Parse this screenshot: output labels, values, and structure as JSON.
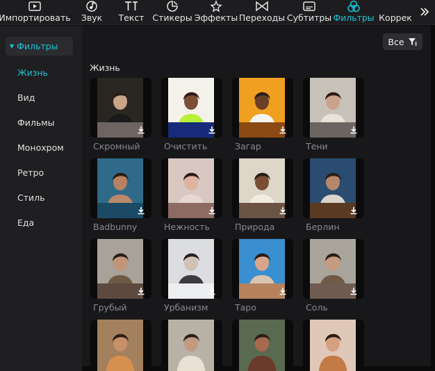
{
  "toolbar": {
    "items": [
      {
        "label": "Импортировать",
        "icon": "import-icon"
      },
      {
        "label": "Звук",
        "icon": "audio-icon"
      },
      {
        "label": "Текст",
        "icon": "text-icon"
      },
      {
        "label": "Стикеры",
        "icon": "sticker-icon"
      },
      {
        "label": "Эффекты",
        "icon": "effects-icon"
      },
      {
        "label": "Переходы",
        "icon": "transitions-icon"
      },
      {
        "label": "Субтитры",
        "icon": "subtitles-icon"
      },
      {
        "label": "Фильтры",
        "icon": "filters-icon",
        "active": true
      },
      {
        "label": "Коррек",
        "icon": "adjust-icon"
      }
    ],
    "accent": "#19c6d6"
  },
  "sidebar": {
    "header": "Фильтры",
    "items": [
      "Жизнь",
      "Вид",
      "Фильмы",
      "Монохром",
      "Ретро",
      "Стиль",
      "Еда"
    ],
    "active": "Жизнь"
  },
  "main": {
    "filter_button": "Все",
    "section_title": "Жизнь",
    "cards": [
      {
        "label": "Скромный",
        "bg": "#2a2622",
        "subject": "#1a1a1a",
        "skin": "#c9a58a",
        "swatch": "#6e6461"
      },
      {
        "label": "Очистить",
        "bg": "#f4f1ea",
        "subject": "#b8f03a",
        "skin": "#7b4f35",
        "swatch": "#182a7a"
      },
      {
        "label": "Загар",
        "bg": "#f0a020",
        "subject": "#f5f5f0",
        "skin": "#6a3f28",
        "swatch": "#8a4a12"
      },
      {
        "label": "Тени",
        "bg": "#c8c1b8",
        "subject": "#e8e2d8",
        "skin": "#c9a38c",
        "swatch": "#6c6461"
      },
      {
        "label": "Badbunny",
        "bg": "#2f6a8a",
        "subject": "#b98a6a",
        "skin": "#b88262",
        "swatch": "#1c4a64"
      },
      {
        "label": "Нежность",
        "bg": "#d9c7c2",
        "subject": "#e8d8d2",
        "skin": "#e0b2a0",
        "swatch": "#8c6b62"
      },
      {
        "label": "Природа",
        "bg": "#ddd6c9",
        "subject": "#f2ece0",
        "skin": "#7a4e34",
        "swatch": "#6c5444"
      },
      {
        "label": "Берлин",
        "bg": "#2a4c70",
        "subject": "#d9d4cc",
        "skin": "#b6876a",
        "swatch": "#5a3a22"
      },
      {
        "label": "Грубый",
        "bg": "#a8a29a",
        "subject": "#6e5a44",
        "skin": "#c49478",
        "swatch": "#5c4a40"
      },
      {
        "label": "Урбанизм",
        "bg": "#dcdde0",
        "subject": "#3c3c3e",
        "skin": "#d0c2b6",
        "swatch": "#eceeef"
      },
      {
        "label": "Таро",
        "bg": "#3a8fd0",
        "subject": "#d9c4b0",
        "skin": "#d8a58a",
        "swatch": "#b5825c"
      },
      {
        "label": "Соль",
        "bg": "#a9a49c",
        "subject": "#6e5a46",
        "skin": "#c69a7e",
        "swatch": "#6e5c52"
      },
      {
        "label": "",
        "bg": "#a3805e",
        "subject": "#d69050",
        "skin": "#c8906a",
        "swatch": "#000000"
      },
      {
        "label": "",
        "bg": "#b8b1a6",
        "subject": "#e8e0d2",
        "skin": "#c29a80",
        "swatch": "#000000"
      },
      {
        "label": "",
        "bg": "#5a6a50",
        "subject": "#6a3a2a",
        "skin": "#a86a4e",
        "swatch": "#000000"
      },
      {
        "label": "",
        "bg": "#e0c8b8",
        "subject": "#c47a44",
        "skin": "#d4a080",
        "swatch": "#000000"
      }
    ]
  }
}
